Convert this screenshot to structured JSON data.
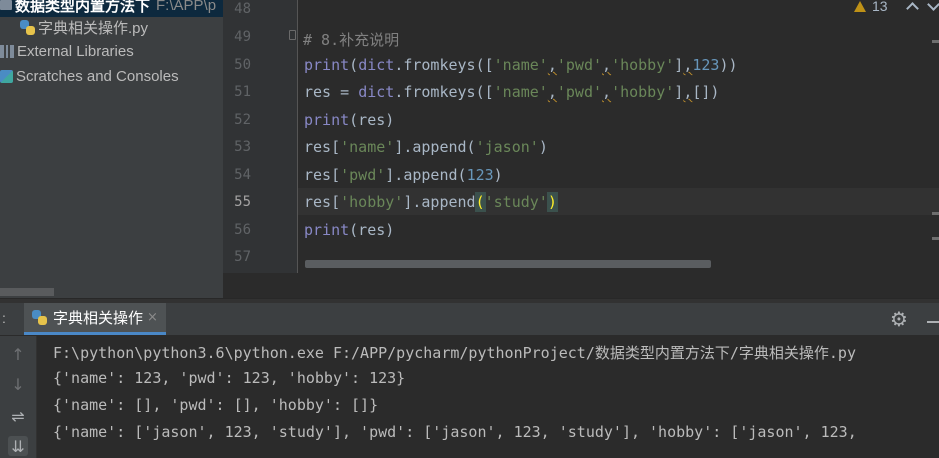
{
  "sidebar": {
    "folder_name": "数据类型内置方法下",
    "folder_path": "F:\\APP\\p",
    "file_name": "字典相关操作.py",
    "external_libraries": "External Libraries",
    "scratches": "Scratches and Consoles"
  },
  "editor": {
    "line_numbers": [
      "48",
      "49",
      "50",
      "51",
      "52",
      "53",
      "54",
      "55",
      "56",
      "57"
    ],
    "active_line": "55",
    "comment": "# 8.补充说明",
    "inspection": {
      "icon": "warning-icon",
      "warning_count": "13"
    },
    "colors": {
      "keyword": "#8888c6",
      "string": "#6a8759",
      "number": "#6897bb",
      "comment": "#808080",
      "text": "#a9b7c6"
    },
    "code": {
      "l50": {
        "print": "print",
        "open": "(",
        "dict": "dict",
        "call": ".fromkeys([",
        "s1": "'name'",
        "c1": ",",
        "s2": "'pwd'",
        "c2": ",",
        "s3": "'hobby'",
        "close": "]",
        "c3": ",",
        "num": "123",
        "end": "))"
      },
      "l51": {
        "lhs": "res = ",
        "dict": "dict",
        "call": ".fromkeys([",
        "s1": "'name'",
        "c1": ",",
        "s2": "'pwd'",
        "c2": ",",
        "s3": "'hobby'",
        "close": "]",
        "c3": ",",
        "end": "[])"
      },
      "l52": {
        "print": "print",
        "rest": "(res)"
      },
      "l53": {
        "pre": "res[",
        "key": "'name'",
        "mid": "].append(",
        "arg": "'jason'",
        "end": ")"
      },
      "l54": {
        "pre": "res[",
        "key": "'pwd'",
        "mid": "].append(",
        "arg": "123",
        "end": ")"
      },
      "l55": {
        "pre": "res[",
        "key": "'hobby'",
        "mid": "].append",
        "open": "(",
        "arg": "'study'",
        "end": ")"
      },
      "l56": {
        "print": "print",
        "rest": "(res)"
      }
    }
  },
  "run_panel": {
    "prefix": ":",
    "tab_label": "字典相关操作",
    "tab_close": "×",
    "command": "F:\\python\\python3.6\\python.exe F:/APP/pycharm/pythonProject/数据类型内置方法下/字典相关操作.py",
    "output": [
      "{'name': 123, 'pwd': 123, 'hobby': 123}",
      "{'name': [], 'pwd': [], 'hobby': []}",
      "{'name': ['jason', 123, 'study'], 'pwd': ['jason', 123, 'study'], 'hobby': ['jason', 123,"
    ],
    "toolbar": {
      "up": "↑",
      "down": "↓",
      "wrap": "⇌",
      "scroll": "⇊"
    },
    "gear": "⚙"
  }
}
